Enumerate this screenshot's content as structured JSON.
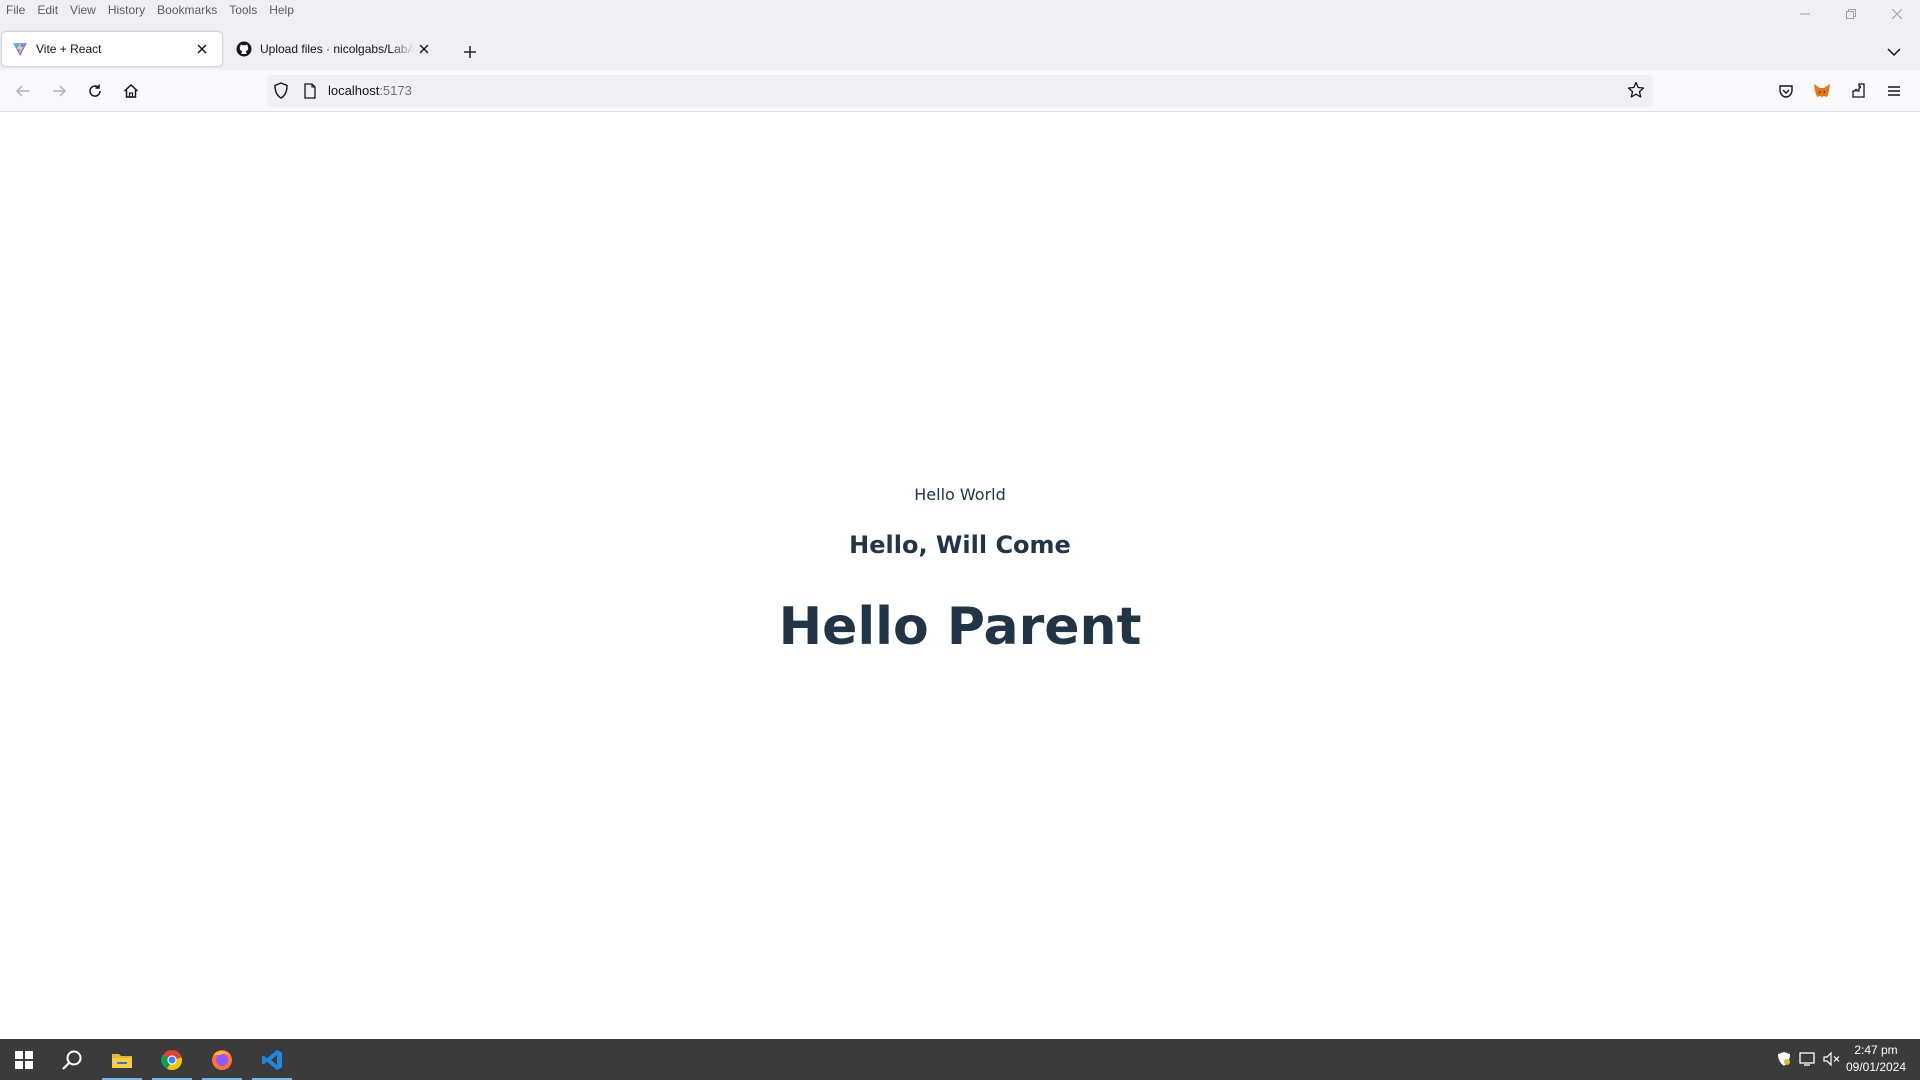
{
  "menu": [
    "File",
    "Edit",
    "View",
    "History",
    "Bookmarks",
    "Tools",
    "Help"
  ],
  "tabs": [
    {
      "title": "Vite + React",
      "icon": "vite-icon",
      "active": true
    },
    {
      "title": "Upload files · nicolgabs/LabActividad",
      "icon": "github-icon",
      "active": false
    }
  ],
  "url": {
    "host": "localhost",
    "port": ":5173"
  },
  "page": {
    "hello_world": "Hello World",
    "hello_will_come": "Hello, Will Come",
    "hello_parent": "Hello Parent"
  },
  "toolbar_icons": [
    "back-icon",
    "forward-icon",
    "reload-icon",
    "home-icon",
    "shield-icon",
    "page-icon",
    "bookmark-star-icon",
    "pocket-icon",
    "metamask-icon",
    "extensions-icon",
    "menu-icon"
  ],
  "taskbar": {
    "apps": [
      "windows-start-icon",
      "search-icon",
      "file-explorer-icon",
      "chrome-icon",
      "firefox-icon",
      "vscode-icon"
    ],
    "time": "2:47 pm",
    "date": "09/01/2024"
  },
  "colors": {
    "text": "#213547",
    "chrome_bg": "#f0f0f4",
    "taskbar_bg": "#3b3b3b"
  }
}
